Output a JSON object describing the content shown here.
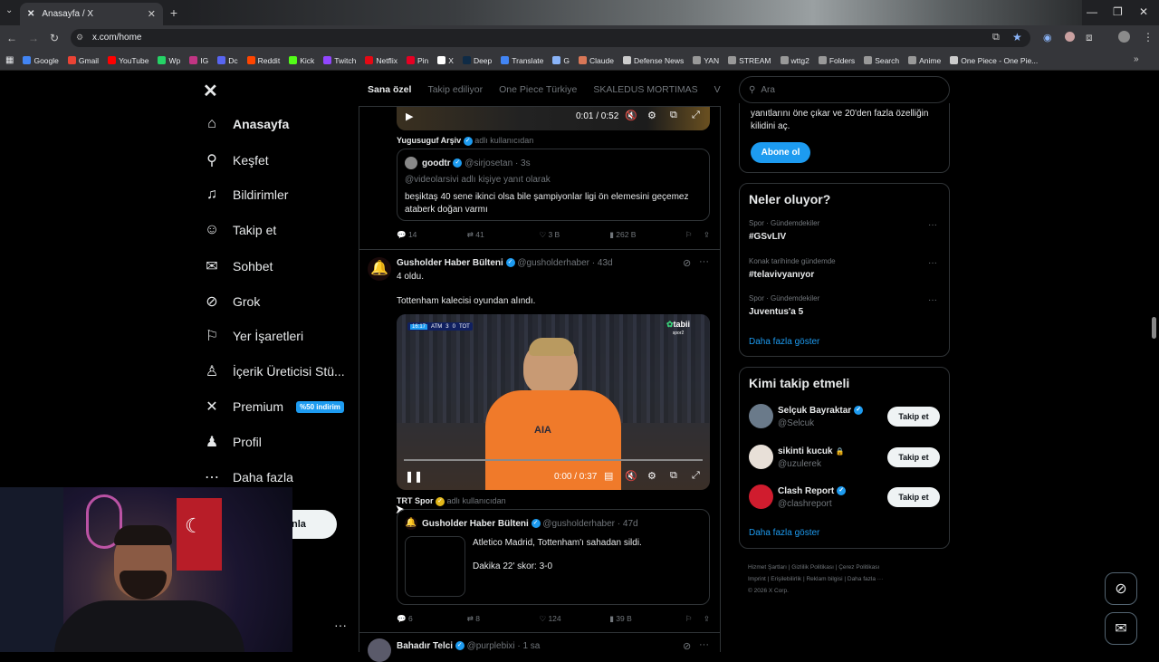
{
  "browser": {
    "tab_title": "Anasayfa / X",
    "url": "x.com/home",
    "bookmarks": [
      {
        "label": "Google",
        "color": "#4285f4"
      },
      {
        "label": "Gmail",
        "color": "#ea4335"
      },
      {
        "label": "YouTube",
        "color": "#ff0000"
      },
      {
        "label": "Wp",
        "color": "#25d366"
      },
      {
        "label": "IG",
        "color": "#c13584"
      },
      {
        "label": "Dc",
        "color": "#5865f2"
      },
      {
        "label": "Reddit",
        "color": "#ff4500"
      },
      {
        "label": "Kick",
        "color": "#53fc18"
      },
      {
        "label": "Twitch",
        "color": "#9146ff"
      },
      {
        "label": "Netflix",
        "color": "#e50914"
      },
      {
        "label": "Pin",
        "color": "#e60023"
      },
      {
        "label": "X",
        "color": "#ffffff"
      },
      {
        "label": "Deep",
        "color": "#0f2b46"
      },
      {
        "label": "Translate",
        "color": "#4285f4"
      },
      {
        "label": "G",
        "color": "#8ab4f8"
      },
      {
        "label": "Claude",
        "color": "#d97757"
      },
      {
        "label": "Defense News",
        "color": "#cccccc"
      },
      {
        "label": "YAN",
        "color": "#999999"
      },
      {
        "label": "STREAM",
        "color": "#999999"
      },
      {
        "label": "wttg2",
        "color": "#999999"
      },
      {
        "label": "Folders",
        "color": "#999999"
      },
      {
        "label": "Search",
        "color": "#999999"
      },
      {
        "label": "Anime",
        "color": "#999999"
      },
      {
        "label": "One Piece - One Pie...",
        "color": "#cccccc"
      }
    ]
  },
  "sidebar": {
    "items": [
      {
        "label": "Anasayfa",
        "icon": "home-icon",
        "glyph": "⌂"
      },
      {
        "label": "Keşfet",
        "icon": "search-icon",
        "glyph": "⚲"
      },
      {
        "label": "Bildirimler",
        "icon": "bell-icon",
        "glyph": "♫"
      },
      {
        "label": "Takip et",
        "icon": "add-user-icon",
        "glyph": "☺"
      },
      {
        "label": "Sohbet",
        "icon": "mail-icon",
        "glyph": "✉"
      },
      {
        "label": "Grok",
        "icon": "grok-icon",
        "glyph": "⊘"
      },
      {
        "label": "Yer İşaretleri",
        "icon": "bookmark-icon",
        "glyph": "⚐"
      },
      {
        "label": "İçerik Üreticisi Stü...",
        "icon": "creator-studio-icon",
        "glyph": "♙"
      },
      {
        "label": "Premium",
        "icon": "x-premium-icon",
        "glyph": "✕"
      },
      {
        "label": "Profil",
        "icon": "profile-icon",
        "glyph": "♟"
      },
      {
        "label": "Daha fazla",
        "icon": "more-circle-icon",
        "glyph": "⋯"
      }
    ],
    "premium_badge": "%50 indirim",
    "post_button": "nla"
  },
  "timeline": {
    "tabs": [
      "Sana özel",
      "Takip ediliyor",
      "One Piece Türkiye",
      "SKALEDUS MORTIMAS",
      "VE"
    ],
    "video1_time": "0:01 / 0:52",
    "post1": {
      "reply_context": "Yugusuguf Arşiv",
      "reply_suffix": "adlı kullanıcıdan",
      "quote": {
        "name": "goodtr",
        "handle": "@sirjosetan · 3s",
        "context": "@videolarsivi adlı kişiye yanıt olarak",
        "text": "beşiktaş 40 sene ikinci olsa bile şampiyonlar ligi ön elemesini geçemez ataberk doğan varmı"
      },
      "stats": {
        "replies": "14",
        "reposts": "41",
        "likes": "3 B",
        "views": "262 B"
      }
    },
    "post2": {
      "name": "Gusholder Haber Bülteni",
      "handle": "@gusholderhaber · 43d",
      "text1": "4 oldu.",
      "text2": "Tottenham kalecisi oyundan alındı.",
      "video": {
        "time": "0:00 / 0:37",
        "score_clock": "16:17",
        "team1": "ATM",
        "s1": "3",
        "s2": "0",
        "team2": "TOT",
        "logo": "tabii",
        "logo_sub": "spor2"
      },
      "reply_context": "TRT Spor",
      "reply_suffix": "adlı kullanıcıdan",
      "quote": {
        "name": "Gusholder Haber Bülteni",
        "handle": "@gusholderhaber · 47d",
        "text1": "Atletico Madrid, Tottenham'ı sahadan sildi.",
        "text2": "Dakika 22' skor: 3-0"
      },
      "stats": {
        "replies": "6",
        "reposts": "8",
        "likes": "124",
        "views": "39 B"
      }
    },
    "post3": {
      "name": "Bahadır Telci",
      "handle": "@purplebixi · 1 sa"
    }
  },
  "right": {
    "search_placeholder": "Ara",
    "premium": {
      "text1": "yanıtlarını öne çıkar ve 20'den fazla özelliğin",
      "text2": "kilidini aç.",
      "button": "Abone ol"
    },
    "trends": {
      "title": "Neler oluyor?",
      "items": [
        {
          "meta": "Spor · Gündemdekiler",
          "tag": "#GSvLIV"
        },
        {
          "meta": "Konak tarihinde gündemde",
          "tag": "#telavivyanıyor"
        },
        {
          "meta": "Spor · Gündemdekiler",
          "tag": "Juventus'a 5"
        }
      ],
      "more": "Daha fazla göster"
    },
    "follow": {
      "title": "Kimi takip etmeli",
      "items": [
        {
          "name": "Selçuk Bayraktar",
          "handle": "@Selcuk",
          "badge": "verified",
          "button": "Takip et"
        },
        {
          "name": "sikinti kucuk",
          "handle": "@uzulerek",
          "badge": "lock",
          "button": "Takip et"
        },
        {
          "name": "Clash Report",
          "handle": "@clashreport",
          "badge": "verified",
          "button": "Takip et"
        }
      ],
      "more": "Daha fazla göster"
    },
    "footer": {
      "links": [
        "Hizmet Şartları",
        "Gizlilik Politikası",
        "Çerez Politikası",
        "Imprint",
        "Erişilebilirlik",
        "Reklam bilgisi",
        "Daha fazla ···"
      ],
      "copyright": "© 2026 X Corp."
    }
  }
}
